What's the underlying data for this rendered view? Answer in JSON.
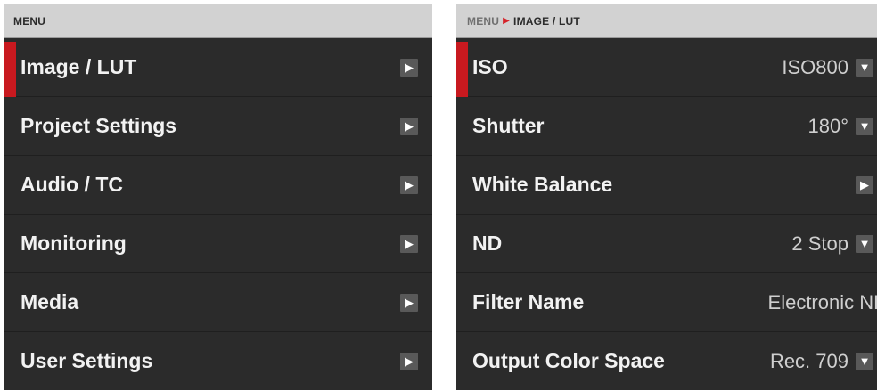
{
  "menu": {
    "header": "MENU",
    "items": [
      {
        "label": "Image / LUT",
        "arrow": "▶"
      },
      {
        "label": "Project Settings",
        "arrow": "▶"
      },
      {
        "label": "Audio / TC",
        "arrow": "▶"
      },
      {
        "label": "Monitoring",
        "arrow": "▶"
      },
      {
        "label": "Media",
        "arrow": "▶"
      },
      {
        "label": "User Settings",
        "arrow": "▶"
      }
    ]
  },
  "submenu": {
    "breadcrumb": {
      "root": "MENU",
      "separator": "▶",
      "current": "IMAGE / LUT"
    },
    "items": [
      {
        "label": "ISO",
        "value": "ISO800",
        "control": "▼"
      },
      {
        "label": "Shutter",
        "value": "180°",
        "control": "▼"
      },
      {
        "label": "White Balance",
        "value": "",
        "control": "▶"
      },
      {
        "label": "ND",
        "value": "2 Stop",
        "control": "▼"
      },
      {
        "label": "Filter Name",
        "value": "Electronic ND",
        "control": ""
      },
      {
        "label": "Output Color Space",
        "value": "Rec. 709",
        "control": "▼"
      }
    ]
  },
  "colors": {
    "accent": "#c8191f",
    "panel": "#2b2b2b",
    "header": "#d2d2d2"
  }
}
